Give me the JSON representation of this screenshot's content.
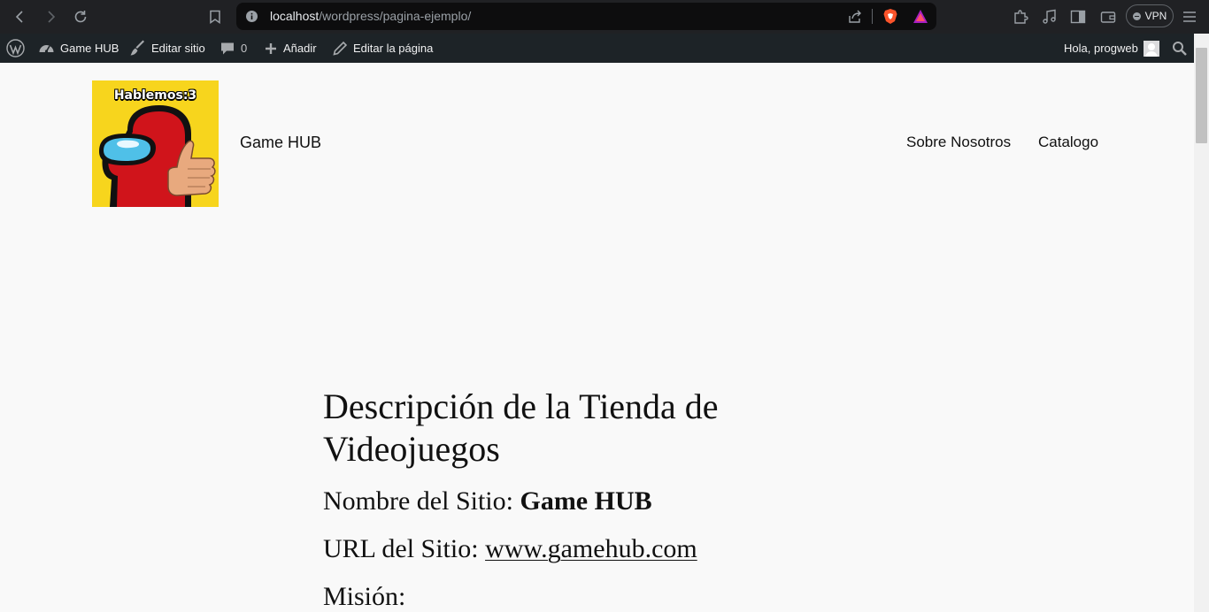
{
  "browser": {
    "url_host": "localhost",
    "url_path": "/wordpress/pagina-ejemplo/",
    "vpn_label": "VPN"
  },
  "adminbar": {
    "site_name": "Game HUB",
    "edit_site": "Editar sitio",
    "comments_count": "0",
    "add_new": "Añadir",
    "edit_page": "Editar la página",
    "greeting": "Hola, progweb"
  },
  "header": {
    "logo_caption": "Hablemos:3",
    "site_title": "Game HUB",
    "nav": [
      "Sobre Nosotros",
      "Catalogo"
    ]
  },
  "content": {
    "title": "Descripción de la Tienda de Videojuegos",
    "site_name_label": "Nombre del Sitio: ",
    "site_name_value": "Game HUB",
    "site_url_label": "URL del Sitio: ",
    "site_url_value": "www.gamehub.com",
    "mission_label": "Misión:"
  }
}
